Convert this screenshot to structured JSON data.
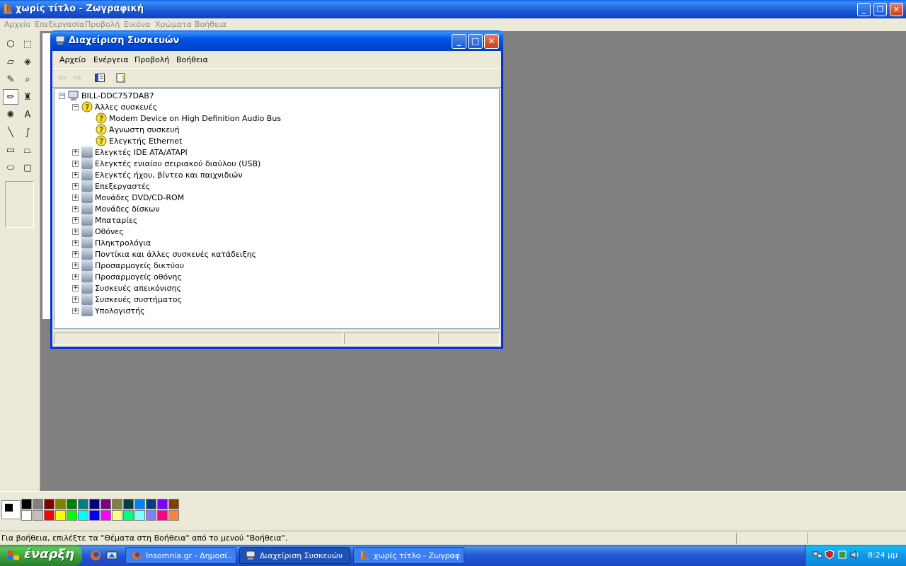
{
  "paint": {
    "title": "χωρίς τίτλο - Ζωγραφική",
    "menu": [
      "Αρχείο",
      "Επεξεργασία",
      "Προβολή",
      "Εικόνα",
      "Χρώματα",
      "Βοήθεια"
    ],
    "tools": [
      {
        "name": "free-select-icon",
        "glyph": "⬡"
      },
      {
        "name": "rect-select-icon",
        "glyph": "⬚"
      },
      {
        "name": "eraser-icon",
        "glyph": "▱"
      },
      {
        "name": "fill-bucket-icon",
        "glyph": "◈"
      },
      {
        "name": "color-picker-icon",
        "glyph": "✎"
      },
      {
        "name": "magnifier-icon",
        "glyph": "⌕"
      },
      {
        "name": "pencil-icon",
        "glyph": "✏"
      },
      {
        "name": "brush-icon",
        "glyph": "♜"
      },
      {
        "name": "airbrush-icon",
        "glyph": "✺"
      },
      {
        "name": "text-icon",
        "glyph": "A"
      },
      {
        "name": "line-icon",
        "glyph": "╲"
      },
      {
        "name": "curve-icon",
        "glyph": "∫"
      },
      {
        "name": "rectangle-icon",
        "glyph": "▭"
      },
      {
        "name": "polygon-icon",
        "glyph": "⏢"
      },
      {
        "name": "ellipse-icon",
        "glyph": "⬭"
      },
      {
        "name": "rounded-rect-icon",
        "glyph": "▢"
      }
    ],
    "active_tool": "pencil-icon",
    "palette_top": [
      "#000000",
      "#808080",
      "#800000",
      "#808000",
      "#008000",
      "#008080",
      "#000080",
      "#800080",
      "#808040",
      "#004040",
      "#0080ff",
      "#004080",
      "#8000ff",
      "#804000"
    ],
    "palette_bottom": [
      "#ffffff",
      "#c0c0c0",
      "#ff0000",
      "#ffff00",
      "#00ff00",
      "#00ffff",
      "#0000ff",
      "#ff00ff",
      "#ffff80",
      "#00ff80",
      "#80ffff",
      "#8080ff",
      "#ff0080",
      "#ff8040"
    ],
    "status": "Για βοήθεια, επιλέξτε τα \"Θέματα στη Βοήθεια\" από το μενού \"Βοήθεια\"."
  },
  "devmgr": {
    "title": "Διαχείριση Συσκευών",
    "menu": [
      "Αρχείο",
      "Ενέργεια",
      "Προβολή",
      "Βοήθεια"
    ],
    "root": "BILL-DDC757DAB7",
    "other_devices": {
      "label": "Άλλες συσκευές",
      "children": [
        "Modem Device on High Definition Audio Bus",
        "Άγνωστη συσκευή",
        "Ελεγκτής Ethernet"
      ]
    },
    "categories": [
      {
        "label": "Ελεγκτές IDE ATA/ATAPI",
        "icon": "ide-controller-icon"
      },
      {
        "label": "Ελεγκτές ενιαίου σειριακού διαύλου (USB)",
        "icon": "usb-icon"
      },
      {
        "label": "Ελεγκτές ήχου, βίντεο και παιχνιδιών",
        "icon": "sound-icon"
      },
      {
        "label": "Επεξεργαστές",
        "icon": "processor-icon"
      },
      {
        "label": "Μονάδες DVD/CD-ROM",
        "icon": "dvd-drive-icon"
      },
      {
        "label": "Μονάδες δίσκων",
        "icon": "disk-drive-icon"
      },
      {
        "label": "Μπαταρίες",
        "icon": "battery-icon"
      },
      {
        "label": "Οθόνες",
        "icon": "monitor-icon"
      },
      {
        "label": "Πληκτρολόγια",
        "icon": "keyboard-icon"
      },
      {
        "label": "Ποντίκια και άλλες συσκευές κατάδειξης",
        "icon": "mouse-icon"
      },
      {
        "label": "Προσαρμογείς δικτύου",
        "icon": "network-adapter-icon"
      },
      {
        "label": "Προσαρμογείς οθόνης",
        "icon": "display-adapter-icon"
      },
      {
        "label": "Συσκευές απεικόνισης",
        "icon": "imaging-device-icon"
      },
      {
        "label": "Συσκευές συστήματος",
        "icon": "system-device-icon"
      },
      {
        "label": "Υπολογιστής",
        "icon": "computer-icon"
      }
    ]
  },
  "taskbar": {
    "start_label": "έναρξη",
    "tasks": [
      {
        "label": "Insomnia.gr - Δημοσί...",
        "icon": "firefox-icon"
      },
      {
        "label": "Διαχείριση Συσκευών",
        "icon": "device-manager-icon"
      },
      {
        "label": "χωρίς τίτλο - Ζωγραφ...",
        "icon": "paint-icon"
      }
    ],
    "clock": "8:24 μμ"
  }
}
